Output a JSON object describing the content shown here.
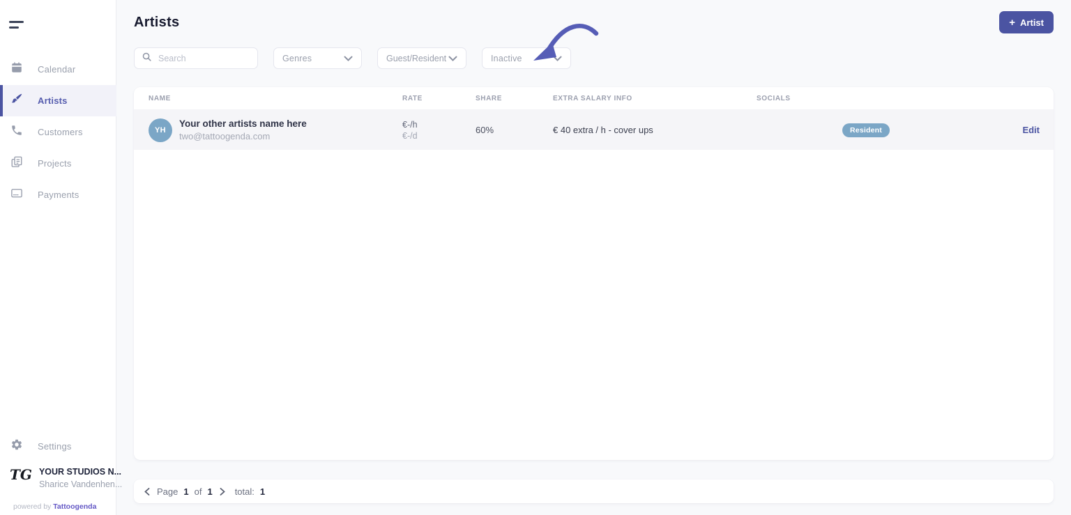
{
  "accent_color": "#4b54a2",
  "badge_color": "#7ba6c6",
  "sidebar": {
    "items": [
      {
        "label": "Calendar",
        "icon": "calendar-icon",
        "active": false
      },
      {
        "label": "Artists",
        "icon": "paintbrush-icon",
        "active": true
      },
      {
        "label": "Customers",
        "icon": "phone-icon",
        "active": false
      },
      {
        "label": "Projects",
        "icon": "documents-icon",
        "active": false
      },
      {
        "label": "Payments",
        "icon": "credit-card-icon",
        "active": false
      }
    ],
    "settings_label": "Settings",
    "studio": {
      "logo_text": "TG",
      "name": "YOUR STUDIOS N...",
      "user": "Sharice Vandenhen..."
    },
    "powered_by": {
      "prefix": "powered by",
      "brand": "Tattoogenda"
    }
  },
  "header": {
    "title": "Artists",
    "add_button": {
      "icon": "plus-icon",
      "label": "Artist"
    }
  },
  "filters": {
    "search_placeholder": "Search",
    "dropdowns": [
      {
        "label": "Genres"
      },
      {
        "label": "Guest/Resident"
      },
      {
        "label": "Inactive"
      }
    ]
  },
  "annotation": {
    "type": "curved-arrow",
    "points_to": "Inactive filter",
    "color": "#565db6"
  },
  "table": {
    "columns": [
      "Name",
      "Rate",
      "Share",
      "Extra salary info",
      "Socials"
    ],
    "rows": [
      {
        "avatar_initials": "YH",
        "name": "Your other artists name here",
        "email": "two@tattoogenda.com",
        "rate_hour": "€-/h",
        "rate_day": "€-/d",
        "share": "60%",
        "extra_salary": "€ 40 extra / h - cover ups",
        "badge": "Resident",
        "edit_label": "Edit"
      }
    ]
  },
  "pagination": {
    "page_label": "Page",
    "current_page": "1",
    "of_label": "of",
    "total_pages": "1",
    "total_label": "total:",
    "total_count": "1"
  }
}
